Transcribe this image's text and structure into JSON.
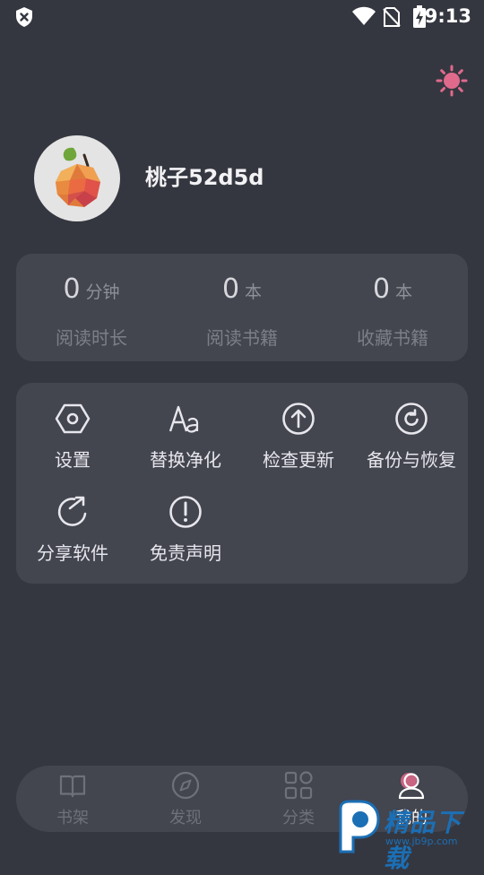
{
  "status_bar": {
    "time": "9:13"
  },
  "profile": {
    "username": "桃子52d5d"
  },
  "stats": [
    {
      "value": "0",
      "unit": "分钟",
      "label": "阅读时长"
    },
    {
      "value": "0",
      "unit": "本",
      "label": "阅读书籍"
    },
    {
      "value": "0",
      "unit": "本",
      "label": "收藏书籍"
    }
  ],
  "menu": [
    {
      "label": "设置",
      "icon": "settings-hexagon-icon"
    },
    {
      "label": "替换净化",
      "icon": "font-aa-icon"
    },
    {
      "label": "检查更新",
      "icon": "arrow-up-circle-icon"
    },
    {
      "label": "备份与恢复",
      "icon": "restore-circle-icon"
    },
    {
      "label": "分享软件",
      "icon": "share-arrow-icon"
    },
    {
      "label": "免责声明",
      "icon": "exclamation-circle-icon"
    }
  ],
  "bottom_nav": [
    {
      "label": "书架",
      "icon": "book-icon",
      "active": false
    },
    {
      "label": "发现",
      "icon": "compass-icon",
      "active": false
    },
    {
      "label": "分类",
      "icon": "grid-icon",
      "active": false
    },
    {
      "label": "我的",
      "icon": "user-icon",
      "active": true
    }
  ],
  "watermark": {
    "text": "精品下载",
    "url": "www.jb9p.com"
  },
  "colors": {
    "background": "#353740",
    "card": "#43454f",
    "accent": "#e06a8c"
  }
}
